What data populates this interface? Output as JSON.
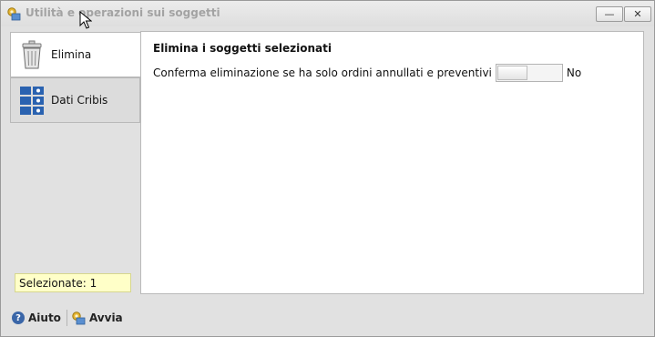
{
  "window": {
    "title": "Utilità e operazioni sui soggetti",
    "minimize_symbol": "—",
    "close_symbol": "✕"
  },
  "sidebar": {
    "tabs": [
      {
        "label": "Elimina",
        "icon": "trash-icon",
        "active": true
      },
      {
        "label": "Dati Cribis",
        "icon": "grid-icon",
        "active": false
      }
    ],
    "selected_label": "Selezionate: 1"
  },
  "content": {
    "title": "Elimina i soggetti selezionati",
    "confirm_label": "Conferma eliminazione se ha solo ordini annullati e preventivi",
    "toggle_value": "No"
  },
  "footer": {
    "help_label": "Aiuto",
    "help_symbol": "?",
    "start_label": "Avvia"
  },
  "colors": {
    "accent": "#3a66a8",
    "selected_bg": "#ffffc8"
  }
}
